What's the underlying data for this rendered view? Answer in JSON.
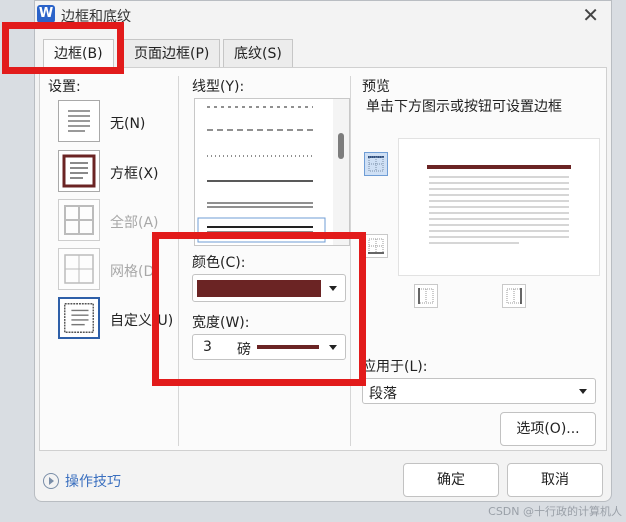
{
  "window": {
    "title": "边框和底纹",
    "app_letter": "W"
  },
  "tabs": [
    {
      "label": "边框(B)",
      "active": true
    },
    {
      "label": "页面边框(P)",
      "active": false
    },
    {
      "label": "底纹(S)",
      "active": false
    }
  ],
  "settings": {
    "label": "设置:",
    "items": [
      {
        "label": "无(N)",
        "enabled": true
      },
      {
        "label": "方框(X)",
        "enabled": true
      },
      {
        "label": "全部(A)",
        "enabled": false
      },
      {
        "label": "网格(D)",
        "enabled": false
      },
      {
        "label": "自定义(U)",
        "enabled": true
      }
    ]
  },
  "line_style": {
    "label": "线型(Y):"
  },
  "color": {
    "label": "颜色(C):",
    "value": "#6b2424"
  },
  "width": {
    "label": "宽度(W):",
    "value": "3",
    "unit": "磅"
  },
  "preview": {
    "label": "预览",
    "hint": "单击下方图示或按钮可设置边框"
  },
  "apply_to": {
    "label": "应用于(L):",
    "value": "段落"
  },
  "buttons": {
    "options": "选项(O)...",
    "ok": "确定",
    "cancel": "取消"
  },
  "tips": {
    "label": "操作技巧"
  },
  "watermark": "CSDN @十行政的计算机人",
  "colors": {
    "highlight": "#e21b1b",
    "border_color": "#6b2424"
  }
}
